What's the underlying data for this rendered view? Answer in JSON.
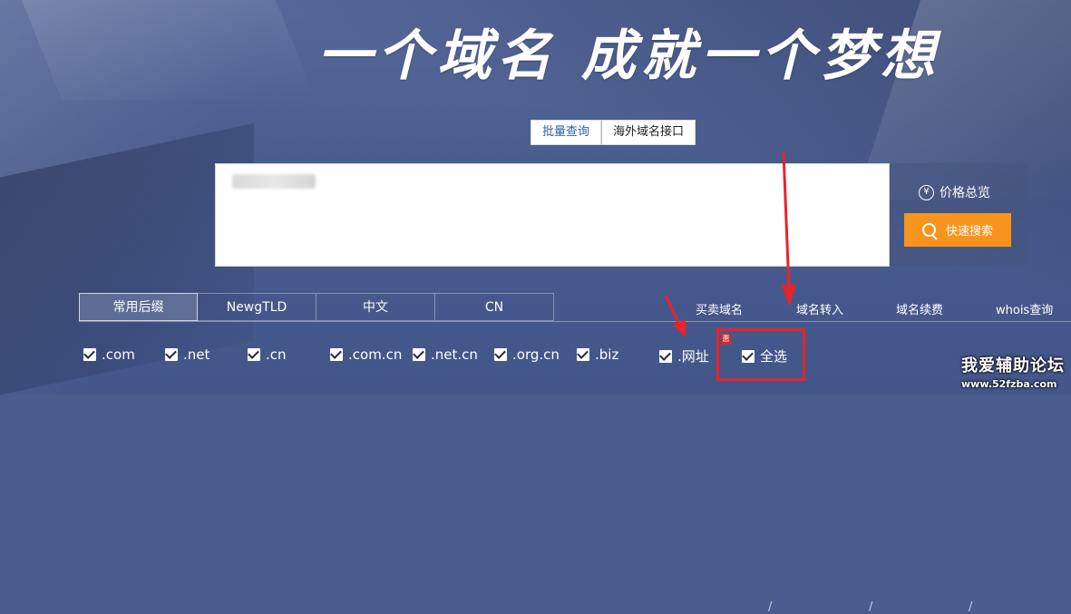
{
  "banner": {
    "slogan": "一个域名 成就一个梦想"
  },
  "query_tabs": [
    {
      "label": "批量查询",
      "active": true
    },
    {
      "label": "海外域名接口",
      "active": false
    }
  ],
  "search": {
    "value": "",
    "placeholder": ""
  },
  "side": {
    "price_label": "价格总览",
    "quick_search_label": "快速搜索",
    "accent": "#f7941d"
  },
  "suffix_tabs": [
    {
      "label": "常用后缀",
      "active": true
    },
    {
      "label": "NewgTLD",
      "active": false
    },
    {
      "label": "中文",
      "active": false
    },
    {
      "label": "CN",
      "active": false
    }
  ],
  "links": [
    "买卖域名",
    "域名转入",
    "域名续费",
    "whois查询"
  ],
  "separator": "/",
  "suffixes": [
    {
      "label": ".com",
      "checked": true
    },
    {
      "label": ".net",
      "checked": true
    },
    {
      "label": ".cn",
      "checked": true
    },
    {
      "label": ".com.cn",
      "checked": true
    },
    {
      "label": ".net.cn",
      "checked": true
    },
    {
      "label": ".org.cn",
      "checked": true
    },
    {
      "label": ".biz",
      "checked": true
    },
    {
      "label": ".网址",
      "checked": true,
      "badge": "惠"
    },
    {
      "label": "全选",
      "checked": true
    }
  ],
  "watermark": {
    "line1": "我爱辅助论坛",
    "line2": "www.52fzba.com"
  },
  "annotation_color": "#e8232a"
}
